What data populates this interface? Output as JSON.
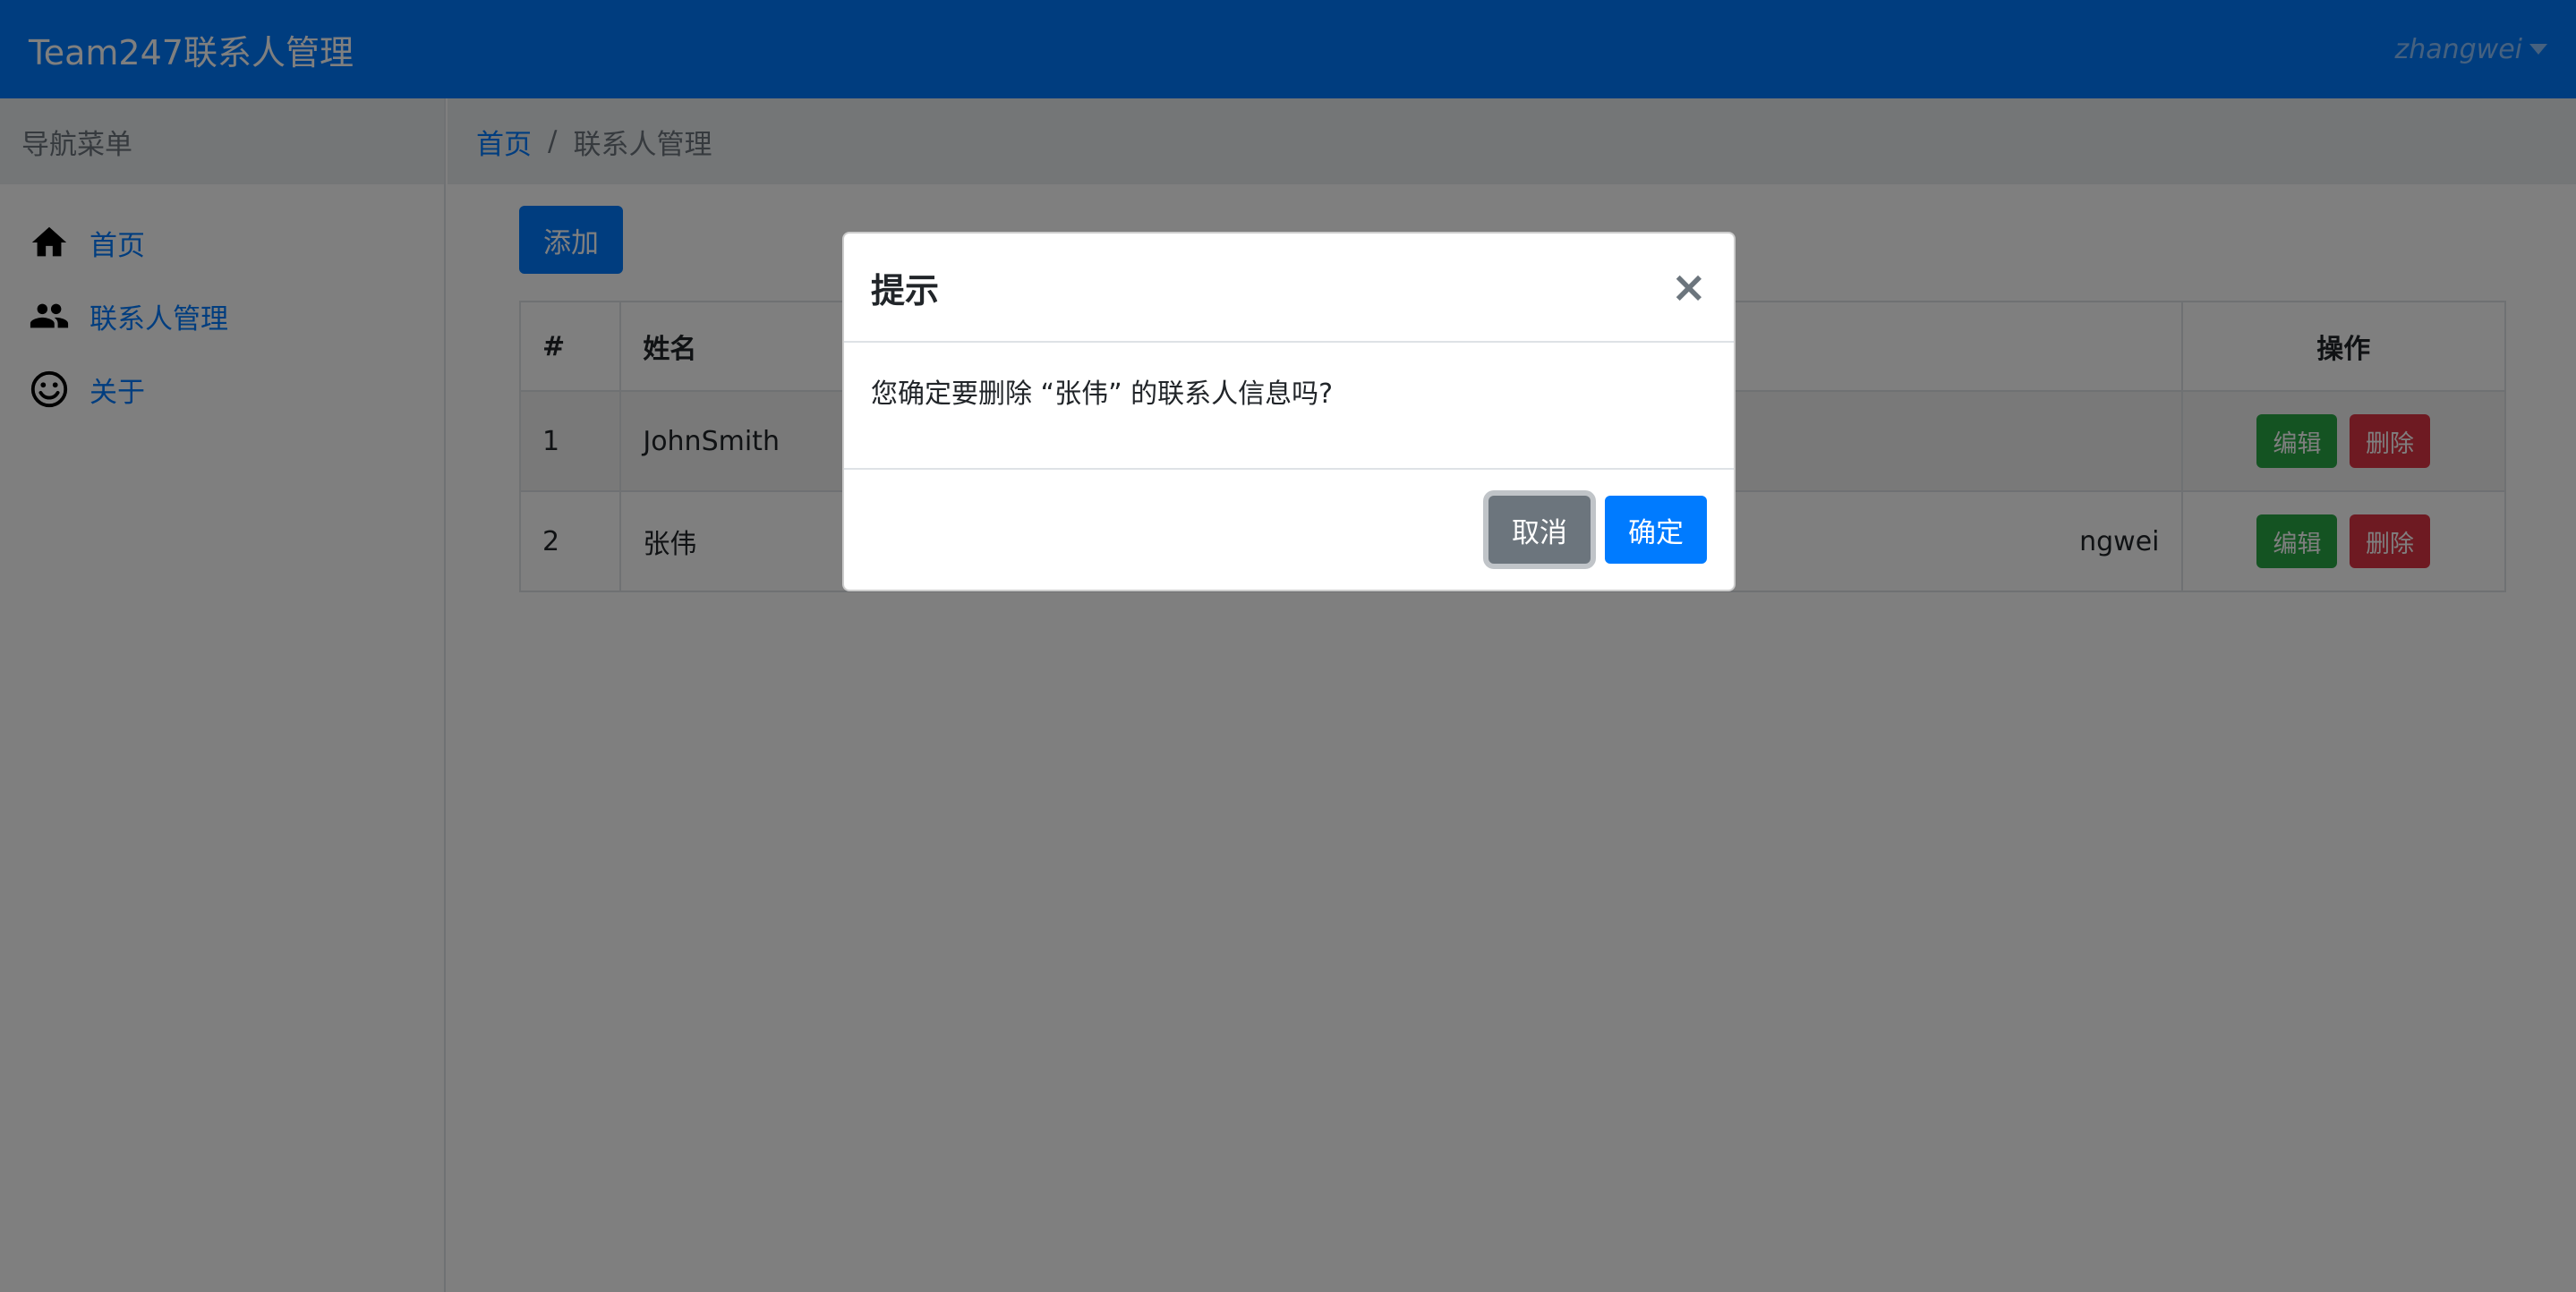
{
  "navbar": {
    "brand": "Team247联系人管理",
    "user": "zhangwei"
  },
  "sidebar": {
    "header": "导航菜单",
    "items": [
      {
        "label": "首页",
        "icon": "home-icon"
      },
      {
        "label": "联系人管理",
        "icon": "people-icon"
      },
      {
        "label": "关于",
        "icon": "smiley-icon"
      }
    ]
  },
  "breadcrumb": {
    "home": "首页",
    "separator": "/",
    "current": "联系人管理"
  },
  "toolbar": {
    "add_label": "添加"
  },
  "table": {
    "headers": {
      "num": "#",
      "name": "姓名",
      "ops": "操作"
    },
    "rows": [
      {
        "num": "1",
        "name": "JohnSmith",
        "partial": "",
        "edit": "编辑",
        "delete": "删除"
      },
      {
        "num": "2",
        "name": "张伟",
        "partial": "ngwei",
        "edit": "编辑",
        "delete": "删除"
      }
    ]
  },
  "modal": {
    "title": "提示",
    "close": "×",
    "message": "您确定要删除 “张伟” 的联系人信息吗?",
    "cancel": "取消",
    "confirm": "确定"
  },
  "colors": {
    "primary": "#007bff",
    "success": "#28a745",
    "danger": "#dc3545",
    "secondary": "#6c757d"
  }
}
